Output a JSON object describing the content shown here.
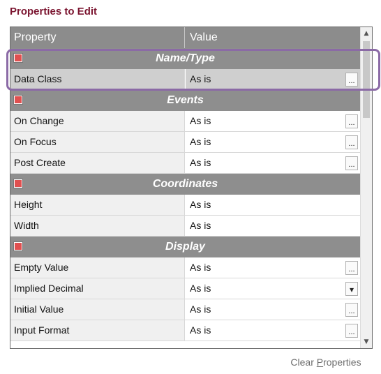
{
  "heading": "Properties to Edit",
  "columns": {
    "property": "Property",
    "value": "Value"
  },
  "categories": {
    "name_type": "Name/Type",
    "events": "Events",
    "coordinates": "Coordinates",
    "display": "Display"
  },
  "rows": {
    "data_class": {
      "name": "Data Class",
      "value": "As is"
    },
    "on_change": {
      "name": "On Change",
      "value": "As is"
    },
    "on_focus": {
      "name": "On Focus",
      "value": "As is"
    },
    "post_create": {
      "name": "Post Create",
      "value": "As is"
    },
    "height": {
      "name": "Height",
      "value": "As is"
    },
    "width": {
      "name": "Width",
      "value": "As is"
    },
    "empty_value": {
      "name": "Empty Value",
      "value": "As is"
    },
    "implied_decimal": {
      "name": "Implied Decimal",
      "value": "As is"
    },
    "initial_value": {
      "name": "Initial Value",
      "value": "As is"
    },
    "input_format": {
      "name": "Input Format",
      "value": "As is"
    }
  },
  "ellipsis": "...",
  "dropdown_glyph": "▾",
  "clear_button": {
    "pre": "Clear ",
    "accel": "P",
    "post": "roperties"
  },
  "colors": {
    "heading": "#7b1530",
    "category_bg": "#8e8e8e",
    "bullet": "#e05050",
    "highlight": "#8b6aa6"
  }
}
